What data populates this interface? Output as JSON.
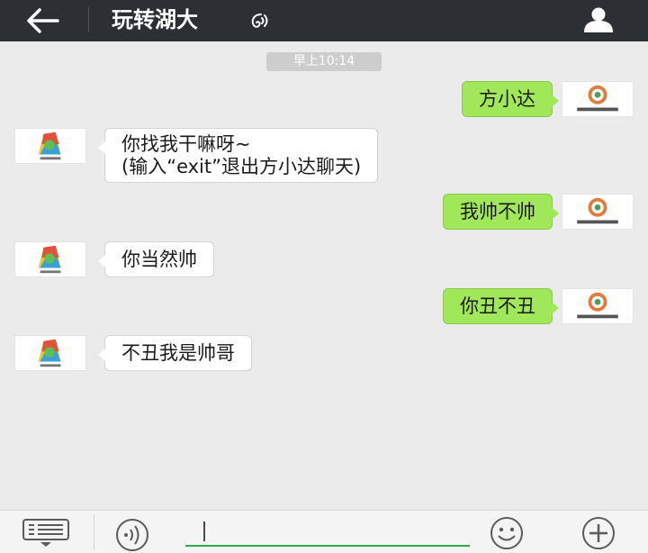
{
  "header": {
    "back_icon": "arrow-left-icon",
    "title": "玩转湖大",
    "title_icon": "voice-ear-icon",
    "profile_icon": "person-icon"
  },
  "chat": {
    "timestamp": "早上10:14",
    "messages": [
      {
        "side": "out",
        "lines": [
          "方小达"
        ]
      },
      {
        "side": "in",
        "lines": [
          "你找我干嘛呀~",
          "(输入“exit”退出方小达聊天)"
        ]
      },
      {
        "side": "out",
        "lines": [
          "我帅不帅"
        ]
      },
      {
        "side": "in",
        "lines": [
          "你当然帅"
        ]
      },
      {
        "side": "out",
        "lines": [
          "你丑不丑"
        ]
      },
      {
        "side": "in",
        "lines": [
          "不丑我是帅哥"
        ]
      }
    ]
  },
  "input_bar": {
    "menu_icon": "keyboard-menu-icon",
    "voice_icon": "voice-input-icon",
    "text": "",
    "emoji_icon": "smiley-icon",
    "plus_icon": "plus-circle-icon"
  },
  "colors": {
    "header_bg": "#2c2f33",
    "chat_bg": "#ebebeb",
    "outgoing_bubble": "#a0e75a",
    "incoming_bubble": "#ffffff",
    "input_underline": "#35a54e"
  }
}
